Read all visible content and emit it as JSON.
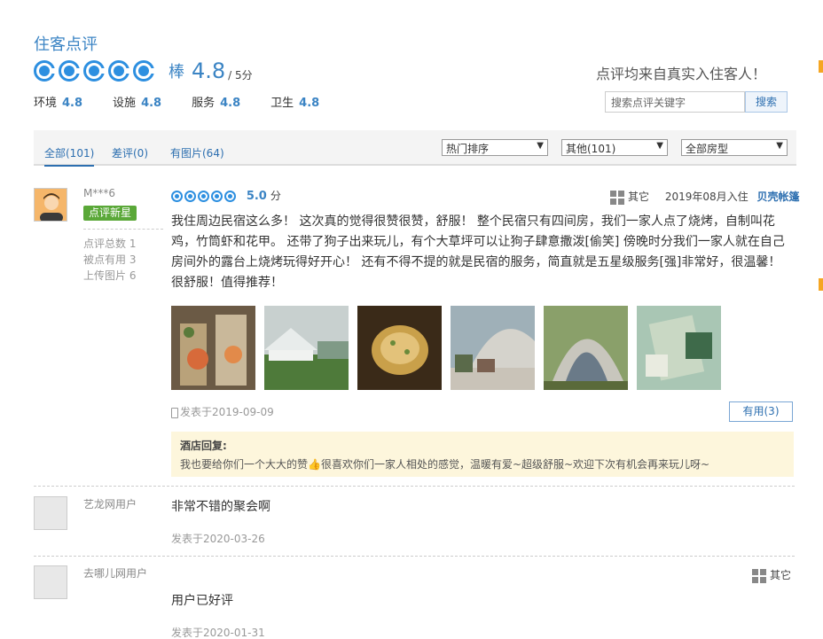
{
  "header": {
    "title": "住客点评",
    "rating_word": "棒",
    "score": "4.8",
    "out_of": "/ 5分",
    "claim": "点评均来自真实入住客人！",
    "sub_scores": [
      {
        "label": "环境",
        "value": "4.8"
      },
      {
        "label": "设施",
        "value": "4.8"
      },
      {
        "label": "服务",
        "value": "4.8"
      },
      {
        "label": "卫生",
        "value": "4.8"
      }
    ],
    "search_placeholder": "搜索点评关键字",
    "search_button": "搜索"
  },
  "tabs": [
    {
      "label": "全部(101)",
      "active": true
    },
    {
      "label": "差评(0)",
      "active": false
    },
    {
      "label": "有图片(64)",
      "active": false
    }
  ],
  "filters": [
    {
      "label": "热门排序"
    },
    {
      "label": "其他(101)"
    },
    {
      "label": "全部房型"
    }
  ],
  "reviews": [
    {
      "user": "M***6",
      "badge": "点评新星",
      "stats": [
        "点评总数 1",
        "被点有用 3",
        "上传图片 6"
      ],
      "score": "5.0",
      "score_unit": "分",
      "room_type": "其它",
      "stay_date": "2019年08月入住",
      "room_name": "贝壳帐篷",
      "text": "我住周边民宿这么多！ 这次真的觉得很赞很赞，舒服！ 整个民宿只有四间房，我们一家人点了烧烤，自制叫花鸡，竹筒虾和花甲。 还带了狗子出来玩儿，有个大草坪可以让狗子肆意撒泼[偷笑] 傍晚时分我们一家人就在自己房间外的露台上烧烤玩得好开心！ 还有不得不提的就是民宿的服务，简直就是五星级服务[强]非常好，很温馨！很舒服！值得推荐！",
      "posted": "发表于2019-09-09",
      "useful": "有用(3)",
      "reply_title": "酒店回复:",
      "reply_text": "我也要给你们一个大大的赞👍很喜欢你们一家人相处的感觉，温暖有爱~超级舒服~欢迎下次有机会再来玩儿呀~"
    },
    {
      "user": "艺龙网用户",
      "text": "非常不错的聚会啊",
      "posted": "发表于2020-03-26"
    },
    {
      "user": "去哪儿网用户",
      "room_type": "其它",
      "text": "用户已好评",
      "posted": "发表于2020-01-31"
    }
  ],
  "colors": {
    "accent": "#2d8fe0",
    "link": "#2d6fb0",
    "badge": "#5aa838",
    "reply_bg": "#fdf6dc"
  }
}
